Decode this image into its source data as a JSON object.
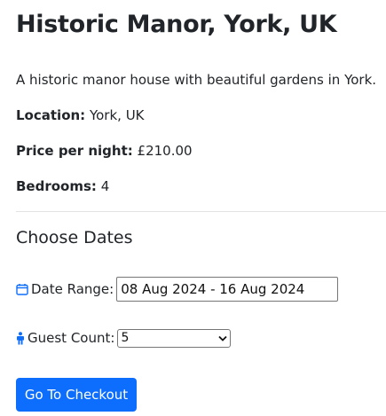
{
  "listing": {
    "title": "Historic Manor, York, UK",
    "description": "A historic manor house with beautiful gardens in York.",
    "location_label": "Location:",
    "location_value": "York, UK",
    "price_label": "Price per night:",
    "price_value": "£210.00",
    "bedrooms_label": "Bedrooms:",
    "bedrooms_value": "4"
  },
  "booking": {
    "heading": "Choose Dates",
    "date_range_label": "Date Range:",
    "date_range_value": "08 Aug 2024 - 16 Aug 2024",
    "guest_count_label": "Guest Count:",
    "guest_count_selected": "5",
    "checkout_label": "Go To Checkout"
  },
  "icons": {
    "date": "calendar-icon",
    "guest": "person-icon"
  },
  "colors": {
    "accent": "#0d6efd",
    "text": "#212529",
    "button_text": "#ffffff"
  }
}
